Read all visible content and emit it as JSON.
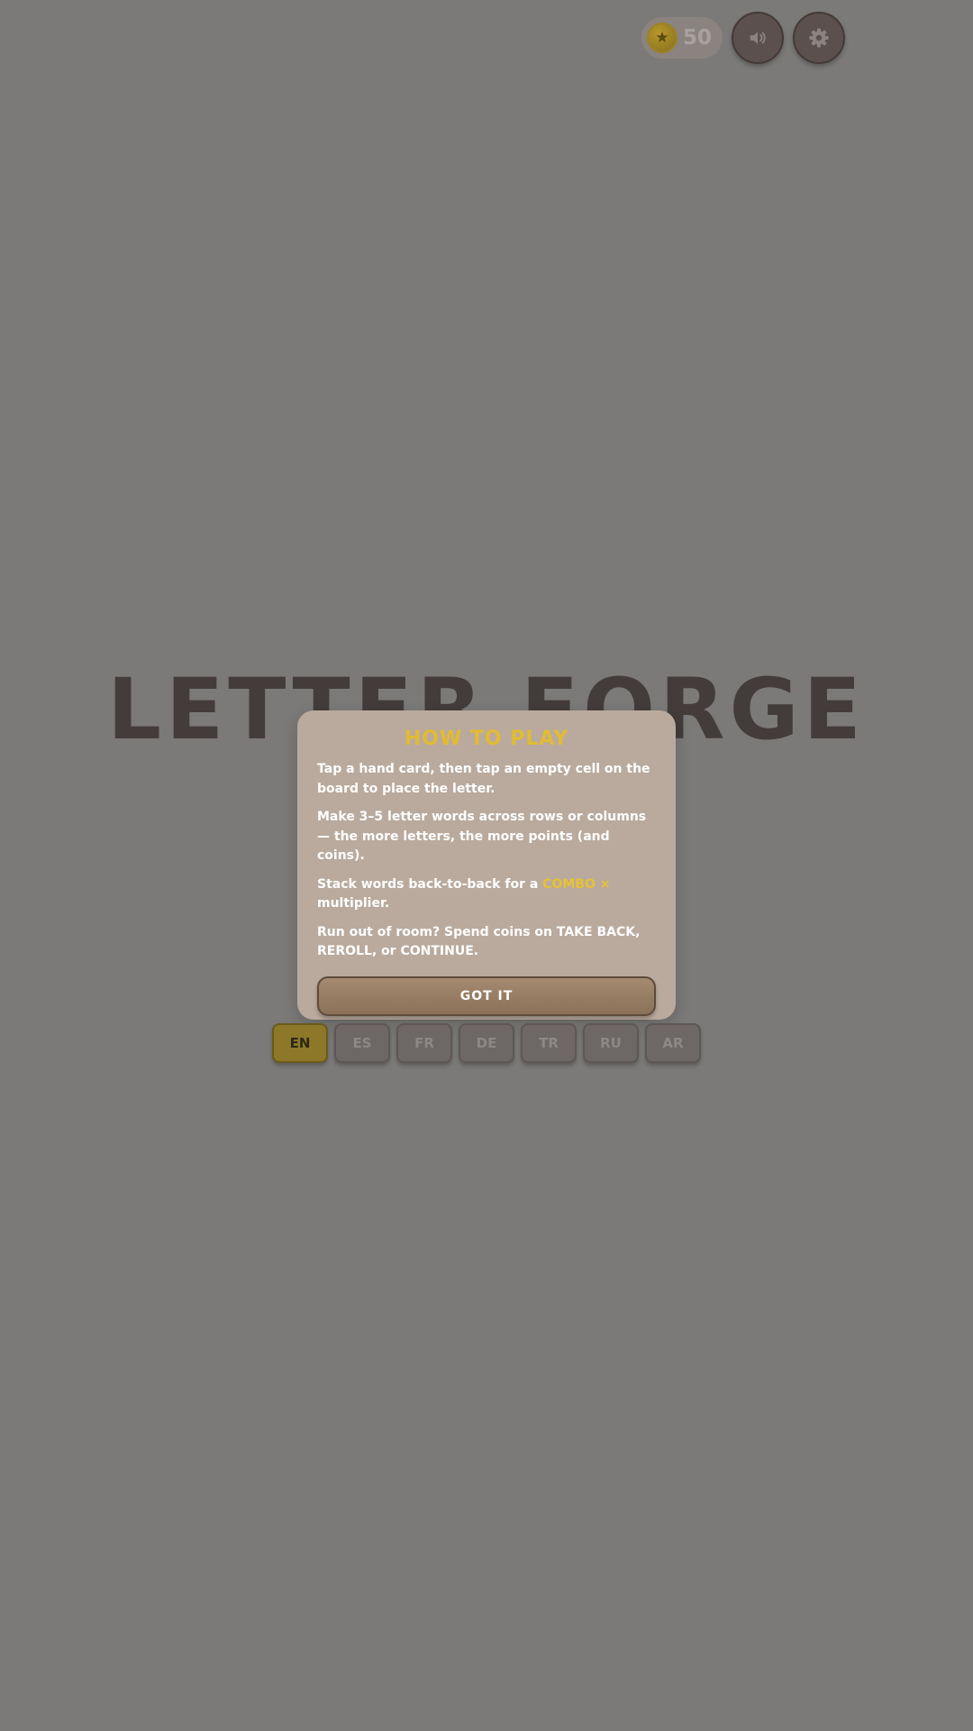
{
  "hud": {
    "coins": "50",
    "coin_icon": "star-coin-icon",
    "sound_icon": "speaker-icon",
    "settings_icon": "gear-icon"
  },
  "title": "LETTER FORGE",
  "how_to_play": {
    "heading": "HOW TO PLAY",
    "p1": "Tap a hand card, then tap an empty cell on the board to place the letter.",
    "p2": "Make 3–5 letter words across rows or columns — the more letters, the more points (and coins).",
    "p3_before": "Stack words back-to-back for a ",
    "p3_highlight": "COMBO ×",
    "p3_after": " multiplier.",
    "p4": "Run out of room? Spend coins on TAKE BACK, REROLL, or CONTINUE.",
    "button": "GOT IT"
  },
  "languages": [
    {
      "code": "EN",
      "active": true
    },
    {
      "code": "ES",
      "active": false
    },
    {
      "code": "FR",
      "active": false
    },
    {
      "code": "DE",
      "active": false
    },
    {
      "code": "TR",
      "active": false
    },
    {
      "code": "RU",
      "active": false
    },
    {
      "code": "AR",
      "active": false
    }
  ],
  "colors": {
    "background": "#7b7a78",
    "accent_gold": "#e2bb33",
    "modal": "#b9aa9d",
    "title": "#433c3b"
  }
}
